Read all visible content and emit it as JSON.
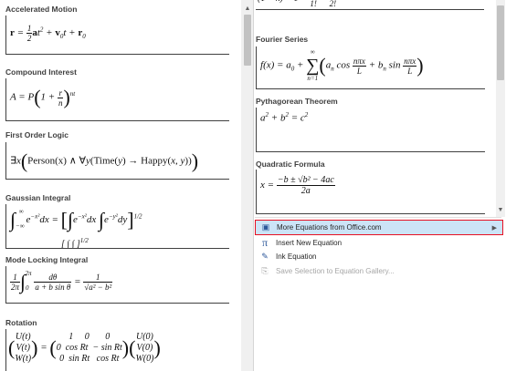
{
  "left_gallery": {
    "sections": [
      {
        "title": "Accelerated Motion"
      },
      {
        "title": "Compound Interest"
      },
      {
        "title": "First Order Logic"
      },
      {
        "title": "Gaussian Integral"
      },
      {
        "title": "Mode Locking Integral"
      },
      {
        "title": "Rotation"
      }
    ]
  },
  "right_gallery": {
    "sections": [
      {
        "title": "Fourier Series"
      },
      {
        "title": "Pythagorean Theorem"
      },
      {
        "title": "Quadratic Formula"
      }
    ]
  },
  "menu": {
    "more_equations": "More Equations from Office.com",
    "insert_new": "Insert New Equation",
    "ink_equation": "Ink Equation",
    "save_selection": "Save Selection to Equation Gallery..."
  },
  "colors": {
    "highlight": "#cce4f7",
    "highlight_border": "#e81123",
    "accent": "#2b579a"
  }
}
